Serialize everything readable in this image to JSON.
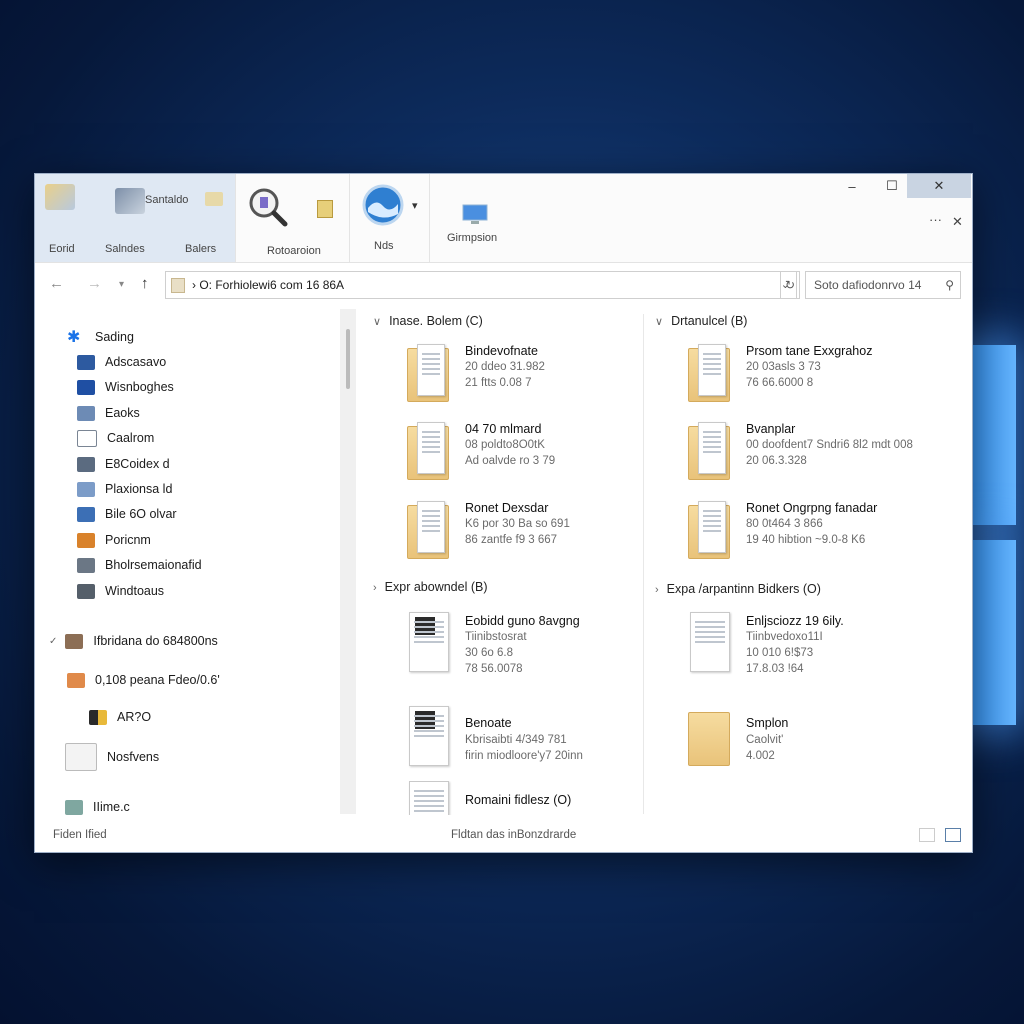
{
  "ribbon": {
    "group_label": "Santaldo",
    "tabs": [
      "Eorid",
      "Salndes",
      "Balers"
    ],
    "tools": [
      {
        "label": "Rotoaroion",
        "icon": "magnifier-icon"
      },
      {
        "label": "Nds",
        "icon": "globe-icon"
      },
      {
        "label": "Girmpsion",
        "icon": "monitor-icon"
      }
    ],
    "more": "···",
    "close_pane": "✕"
  },
  "window_controls": {
    "minimize": "‒",
    "maximize": "☐",
    "close": "✕"
  },
  "address": {
    "path": "› O: Forhiolewi6 com 16 86A",
    "search_placeholder": "Soto dafiodonrvo 14"
  },
  "sidebar": {
    "items": [
      {
        "label": "Sading",
        "icon": "star-icon",
        "color": "#1a73e8"
      },
      {
        "label": "Adscasavo",
        "icon": "desktop-icon",
        "color": "#2d5aa0"
      },
      {
        "label": "Wisnboghes",
        "icon": "window-icon",
        "color": "#1f4fa3"
      },
      {
        "label": "Eaoks",
        "icon": "books-icon",
        "color": "#6d8bb5"
      },
      {
        "label": "Caalrom",
        "icon": "document-icon",
        "color": "#7a8594"
      },
      {
        "label": "E8Coidex d",
        "icon": "drive-icon",
        "color": "#5b6b80"
      },
      {
        "label": "Plaxionsa ld",
        "icon": "image-icon",
        "color": "#7c9cc8"
      },
      {
        "label": "Bile 6O olvar",
        "icon": "picture-icon",
        "color": "#3c6fb5"
      },
      {
        "label": "Poricnm",
        "icon": "color-icon",
        "color": "#d9822b"
      },
      {
        "label": "Bholrsemaionafid",
        "icon": "list-icon",
        "color": "#6b7785"
      },
      {
        "label": "Windtoaus",
        "icon": "printer-icon",
        "color": "#555f6a"
      }
    ],
    "section": {
      "label": "Ifbridana do 684800ns",
      "icon": "network-icon"
    },
    "sub1": {
      "label": "0,108 peana Fdeo/0.6'",
      "icon": "user-icon"
    },
    "sub2": {
      "label": "AR?O",
      "icon": "app-icon"
    },
    "sub3": {
      "label": "Nosfvens",
      "icon": "note-icon"
    },
    "sub4": {
      "label": "IIime.c",
      "icon": "library-icon"
    }
  },
  "groups": [
    {
      "header": "Inase. Bolem (C)",
      "expanded": true,
      "files": [
        {
          "name": "Bindevofnate",
          "l2": "20 ddeo 31.982",
          "l3": "21 ftts 0.08 7",
          "style": "folder"
        },
        {
          "name": "04 70 mlmard",
          "l2": "08 poldto8O0tK",
          "l3": "Ad oalvde ro 3 79",
          "style": "folder"
        },
        {
          "name": "Ronet Dexsdar",
          "l2": "K6 por 30 Ba so 691",
          "l3": "86 zantfe f9 3 667",
          "style": "folder"
        }
      ]
    },
    {
      "header": "Drtanulcel (B)",
      "expanded": true,
      "files": [
        {
          "name": "Prsom tane Exxgrahoz",
          "l2": "20 03asls 3 73",
          "l3": "76 66.6000 8",
          "style": "folder"
        },
        {
          "name": "Bvanplar",
          "l2": "00 doofdent7 Sndri6 8l2 mdt 008",
          "l3": "20 06.3.328",
          "style": "folder"
        },
        {
          "name": "Ronet Ongrpng fanadar",
          "l2": "80 0t464 3 866",
          "l3": "19 40 hibtion ~9.0-8 K6",
          "style": "folder"
        }
      ]
    },
    {
      "header": "Expr abowndel (B)",
      "expanded": false,
      "files": [
        {
          "name": "Eobidd guno 8avgng",
          "l2": "Tiinibstosrat",
          "l3": "30 6o 6.8",
          "l4": "78 56.0078",
          "style": "dark"
        },
        {
          "name": "Benoate",
          "l2": "Kbrisaibti 4/349 781",
          "l3": "firin miodloore'y7 20inn",
          "style": "doc"
        },
        {
          "name": "Romaini fidlesz (O)",
          "l2": "",
          "l3": "",
          "style": "doc"
        }
      ]
    },
    {
      "header": "Expa /arpantinn Bidkers (O)",
      "expanded": false,
      "files": [
        {
          "name": "Enljsciozz 19 6ily.",
          "l2": "Tiinbvedoxo11I",
          "l3": "10 010 6!$73",
          "l4": "17.8.03 !64",
          "style": "doc"
        },
        {
          "name": "Smplon",
          "l2": "Caolvit'",
          "l3": "4.002",
          "style": "folder"
        }
      ]
    }
  ],
  "status": {
    "left": "Fiden Ified",
    "center": "Fldtan das inBonzdrarde"
  }
}
